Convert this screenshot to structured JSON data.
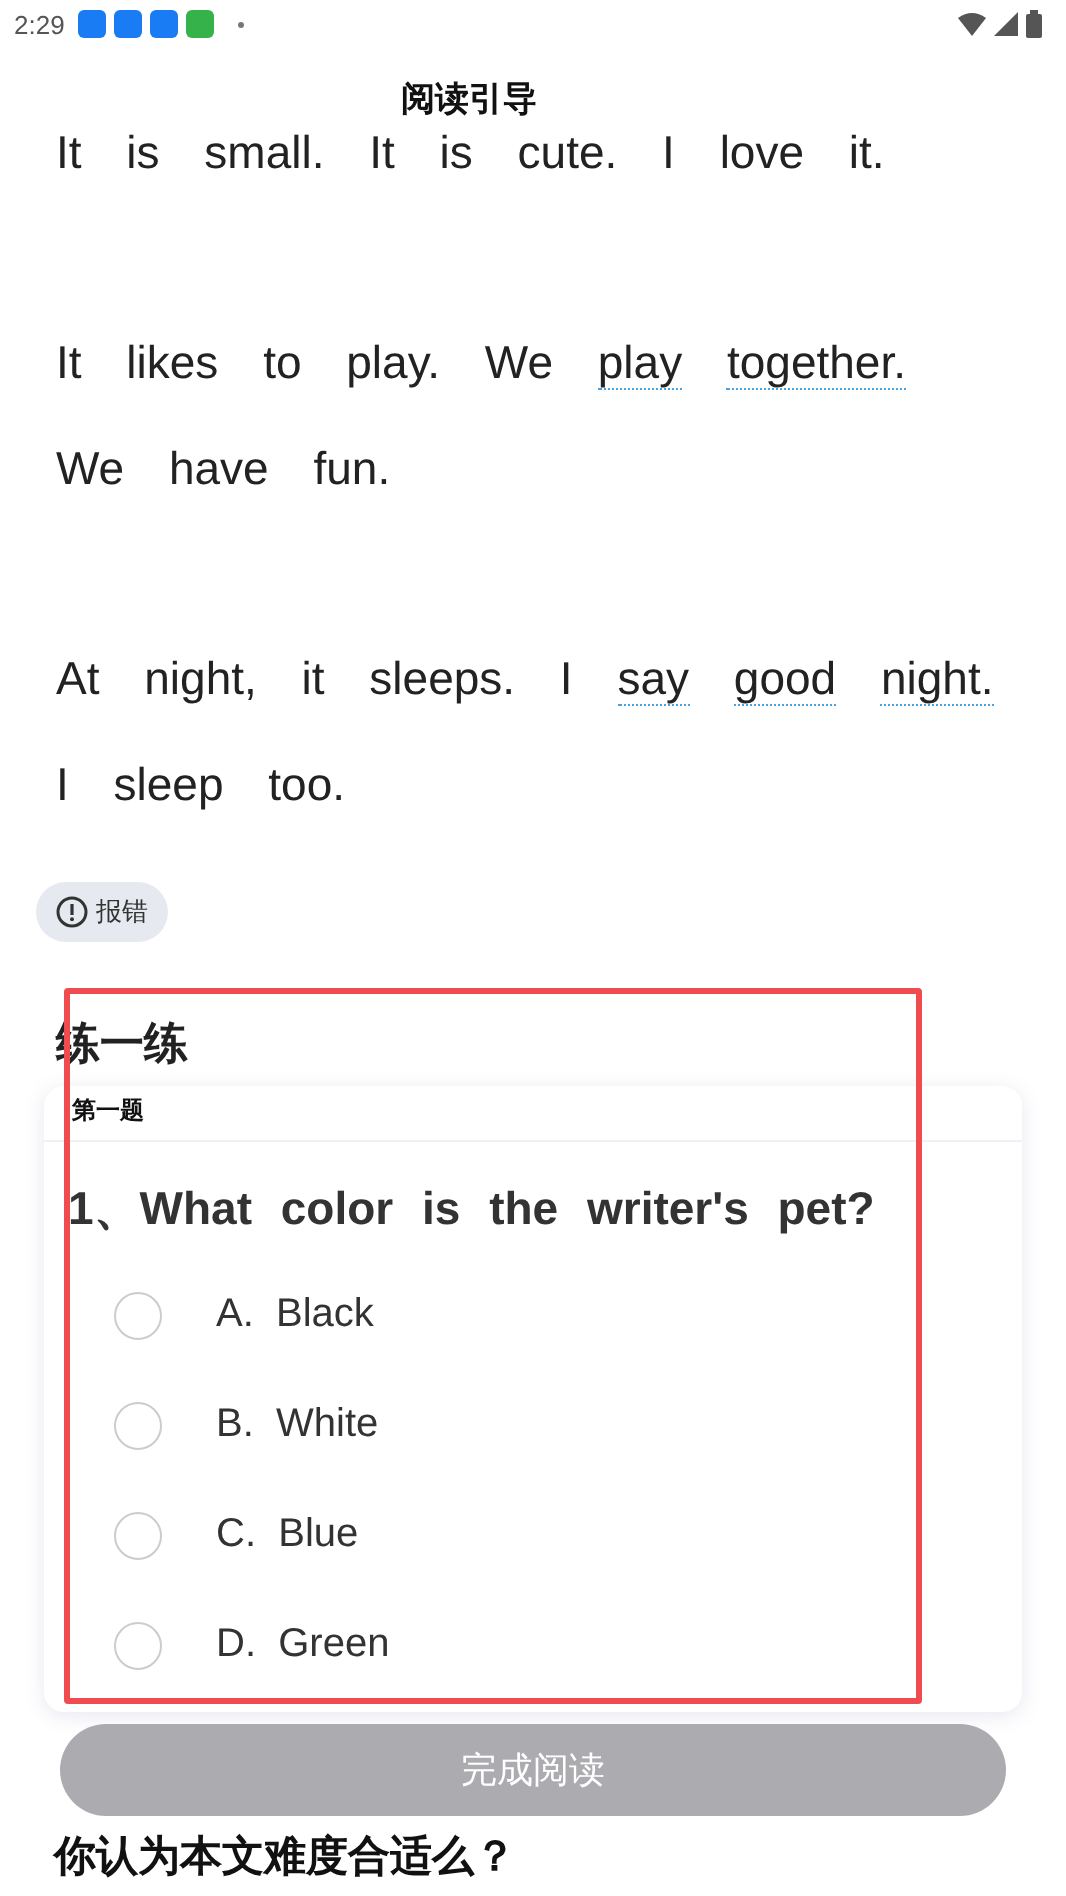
{
  "status_bar": {
    "time": "2:29"
  },
  "header": {
    "title": "阅读引导"
  },
  "article": {
    "paragraphs": [
      [
        {
          "text": "It is small. It is cute. I love it.",
          "highlighted": false
        }
      ],
      [
        {
          "text": "It likes to play. We",
          "highlighted": false
        },
        {
          "text": "play",
          "highlighted": true
        },
        {
          "text": "together.",
          "highlighted": true
        },
        {
          "text": "We have fun.",
          "highlighted": false
        }
      ],
      [
        {
          "text": "At night, it sleeps. I",
          "highlighted": false
        },
        {
          "text": "say",
          "highlighted": true
        },
        {
          "text": "good",
          "highlighted": true
        },
        {
          "text": "night.",
          "highlighted": true
        },
        {
          "text": "I sleep too.",
          "highlighted": false
        }
      ]
    ]
  },
  "report_button": {
    "label": "报错"
  },
  "practice": {
    "title": "练一练",
    "card_title": "第一题",
    "question": "1、What color is the writer's pet?",
    "options": [
      {
        "letter": "A.",
        "text": "Black",
        "selected": false
      },
      {
        "letter": "B.",
        "text": "White",
        "selected": false
      },
      {
        "letter": "C.",
        "text": "Blue",
        "selected": false
      },
      {
        "letter": "D.",
        "text": "Green",
        "selected": false
      }
    ]
  },
  "finish_button": {
    "label": "完成阅读",
    "disabled": true
  },
  "difficulty": {
    "question": "你认为本文难度合适么？"
  }
}
